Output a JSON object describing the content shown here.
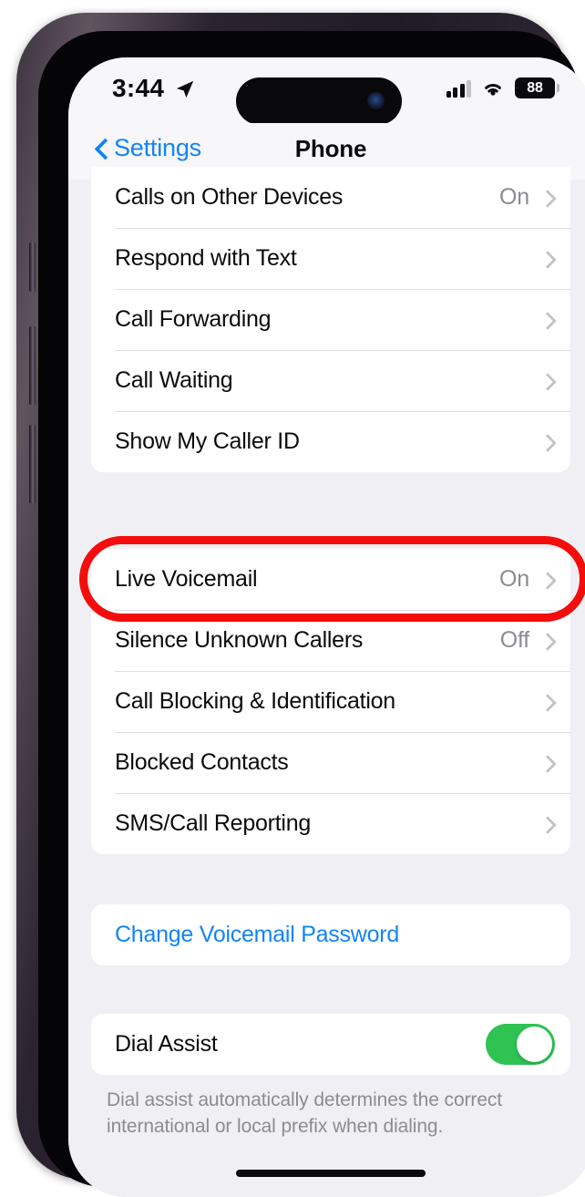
{
  "status_bar": {
    "time": "3:44",
    "location_icon": "location-arrow-icon",
    "cellular_icon": "cellular-signal-icon",
    "wifi_icon": "wifi-icon",
    "battery_percent": "88"
  },
  "nav": {
    "back_label": "Settings",
    "back_icon": "chevron-left-icon",
    "title": "Phone"
  },
  "groups": [
    {
      "name": "call-settings-group",
      "rows": [
        {
          "label": "Calls on Other Devices",
          "value": "On",
          "accessory": "chevron"
        },
        {
          "label": "Respond with Text",
          "value": "",
          "accessory": "chevron"
        },
        {
          "label": "Call Forwarding",
          "value": "",
          "accessory": "chevron"
        },
        {
          "label": "Call Waiting",
          "value": "",
          "accessory": "chevron"
        },
        {
          "label": "Show My Caller ID",
          "value": "",
          "accessory": "chevron"
        }
      ]
    },
    {
      "name": "voicemail-blocking-group",
      "rows": [
        {
          "label": "Live Voicemail",
          "value": "On",
          "accessory": "chevron"
        },
        {
          "label": "Silence Unknown Callers",
          "value": "Off",
          "accessory": "chevron"
        },
        {
          "label": "Call Blocking & Identification",
          "value": "",
          "accessory": "chevron"
        },
        {
          "label": "Blocked Contacts",
          "value": "",
          "accessory": "chevron"
        },
        {
          "label": "SMS/Call Reporting",
          "value": "",
          "accessory": "chevron"
        }
      ]
    },
    {
      "name": "voicemail-password-group",
      "rows": [
        {
          "label": "Change Voicemail Password",
          "value": "",
          "accessory": "none"
        }
      ]
    },
    {
      "name": "dial-assist-group",
      "rows": [
        {
          "label": "Dial Assist",
          "value": "",
          "accessory": "toggle-on"
        }
      ]
    }
  ],
  "footnote": "Dial assist automatically determines the correct international or local prefix when dialing.",
  "annotation": {
    "target": "Live Voicemail",
    "shape": "oval",
    "color": "#f40d0d"
  },
  "colors": {
    "accent_blue": "#1284f7",
    "toggle_green": "#2ec352",
    "annotation_red": "#f40d0d",
    "page_background": "#f0f0f4",
    "card_background": "#ffffff",
    "secondary_text": "#8b8b91"
  }
}
